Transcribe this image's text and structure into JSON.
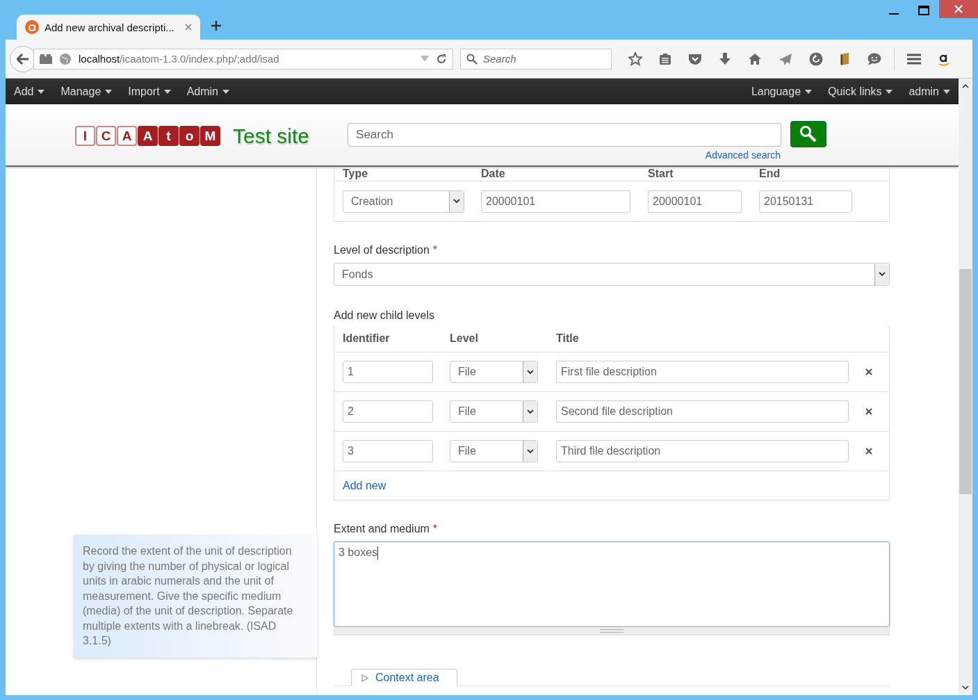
{
  "browser": {
    "tab_title": "Add new archival descripti...",
    "url_host": "localhost",
    "url_path": "/icaatom-1.3.0/index.php/;add/isad",
    "search_placeholder": "Search"
  },
  "nav": {
    "left": [
      "Add",
      "Manage",
      "Import",
      "Admin"
    ],
    "right": [
      "Language",
      "Quick links",
      "admin"
    ]
  },
  "header": {
    "logo": [
      {
        "letter": "I",
        "filled": false
      },
      {
        "letter": "C",
        "filled": false
      },
      {
        "letter": "A",
        "filled": false
      },
      {
        "letter": "A",
        "filled": true
      },
      {
        "letter": "t",
        "filled": true
      },
      {
        "letter": "o",
        "filled": true
      },
      {
        "letter": "M",
        "filled": true
      }
    ],
    "site_name": "Test site",
    "search_placeholder": "Search",
    "advanced_search": "Advanced search"
  },
  "dates": {
    "columns": [
      "Type",
      "Date",
      "Start",
      "End"
    ],
    "row": {
      "type": "Creation",
      "date": "20000101",
      "start": "20000101",
      "end": "20150131"
    }
  },
  "level_of_description": {
    "label": "Level of description",
    "required_mark": "*",
    "value": "Fonds"
  },
  "child_levels": {
    "label": "Add new child levels",
    "columns": [
      "Identifier",
      "Level",
      "Title"
    ],
    "rows": [
      {
        "identifier": "1",
        "level": "File",
        "title": "First file description"
      },
      {
        "identifier": "2",
        "level": "File",
        "title": "Second file description"
      },
      {
        "identifier": "3",
        "level": "File",
        "title": "Third file description"
      }
    ],
    "add_new": "Add new"
  },
  "help_text": "Record the extent of the unit of description by giving the number of physical or logical units in arabic numerals and the unit of measurement. Give the specific medium (media) of the unit of description. Separate multiple extents with a linebreak. (ISAD 3.1.5)",
  "extent": {
    "label": "Extent and medium",
    "required_mark": "*",
    "value": "3 boxes",
    "focused": true
  },
  "context_area": {
    "label": "Context area",
    "expanded": false
  }
}
